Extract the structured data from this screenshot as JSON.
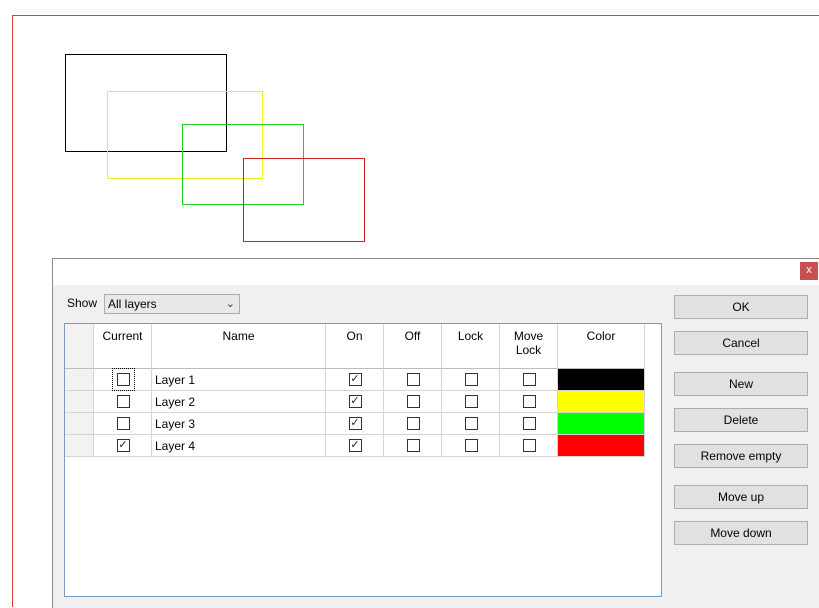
{
  "canvas": {
    "rects": [
      {
        "name": "black-rectangle",
        "color": "#000000"
      },
      {
        "name": "yellow-rectangle",
        "color": "#f0f020"
      },
      {
        "name": "green-rectangle",
        "color": "#22cc22"
      },
      {
        "name": "red-rectangle",
        "color": "#cc2222"
      }
    ]
  },
  "dialog": {
    "close_label": "x",
    "show_label": "Show",
    "show_value": "All layers"
  },
  "table": {
    "columns": [
      "Current",
      "Name",
      "On",
      "Off",
      "Lock",
      "Move Lock",
      "Color"
    ],
    "rows": [
      {
        "name": "Layer 1",
        "current": false,
        "on": true,
        "off": false,
        "lock": false,
        "move_lock": false,
        "color": "#000000"
      },
      {
        "name": "Layer 2",
        "current": false,
        "on": true,
        "off": false,
        "lock": false,
        "move_lock": false,
        "color": "#ffff00"
      },
      {
        "name": "Layer 3",
        "current": false,
        "on": true,
        "off": false,
        "lock": false,
        "move_lock": false,
        "color": "#00ff00"
      },
      {
        "name": "Layer 4",
        "current": true,
        "on": true,
        "off": false,
        "lock": false,
        "move_lock": false,
        "color": "#ff0000"
      }
    ]
  },
  "buttons": {
    "ok": "OK",
    "cancel": "Cancel",
    "new": "New",
    "delete": "Delete",
    "remove_empty": "Remove empty",
    "move_up": "Move up",
    "move_down": "Move down"
  }
}
